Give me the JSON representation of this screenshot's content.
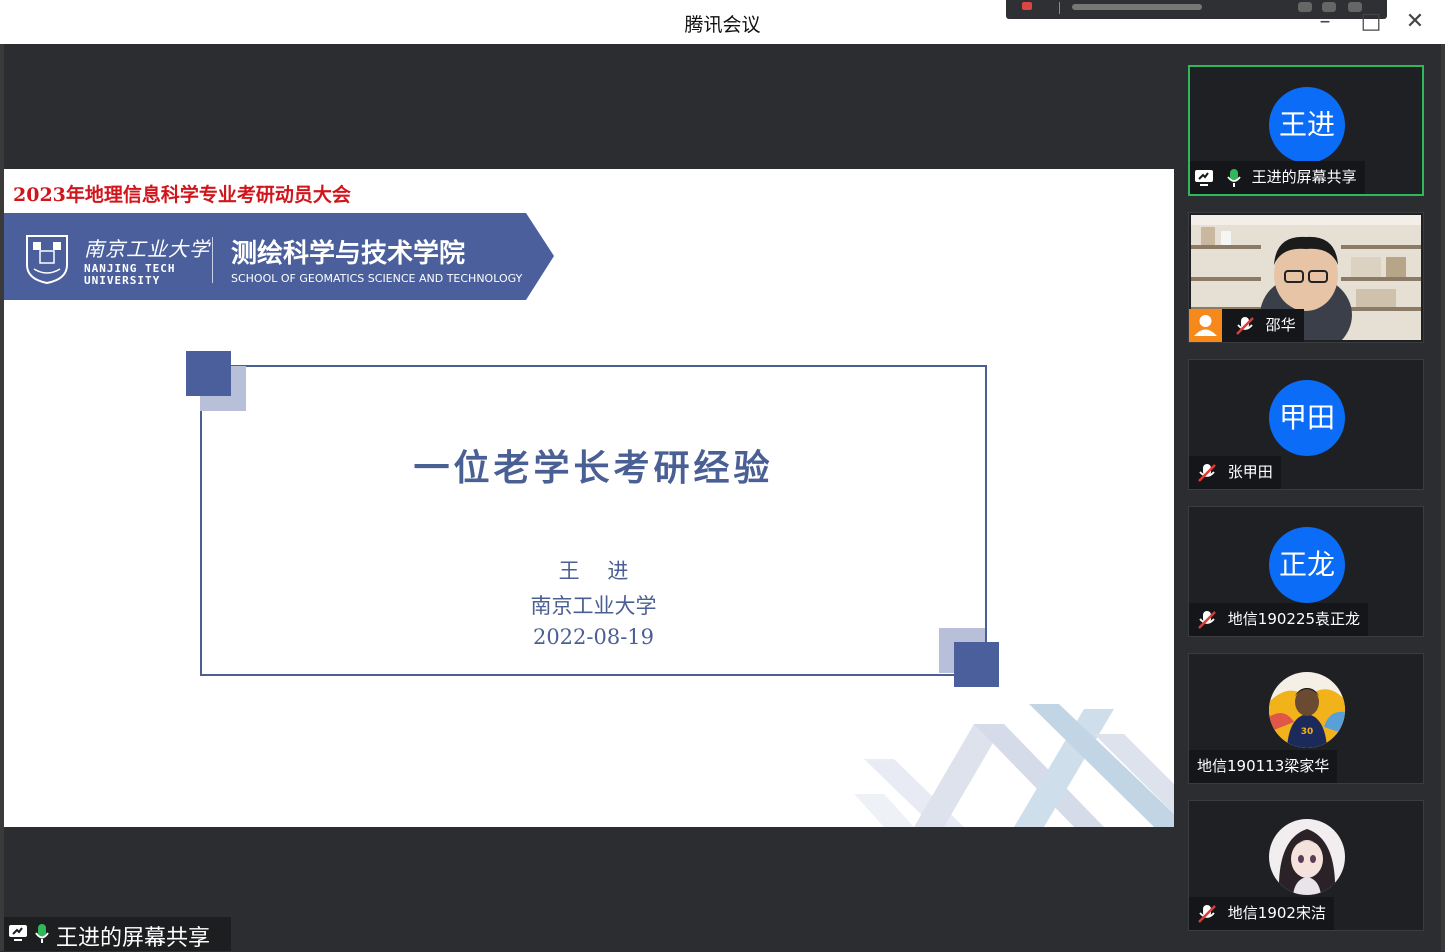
{
  "window": {
    "title": "腾讯会议"
  },
  "slide": {
    "event_title": "2023年地理信息科学专业考研动员大会",
    "university_cn": "南京工业大学",
    "university_en_line1": "NANJING TECH",
    "university_en_line2": "UNIVERSITY",
    "school_cn": "测绘科学与技术学院",
    "school_en": "SCHOOL OF GEOMATICS SCIENCE AND TECHNOLOGY",
    "main_title": "一位老学长考研经验",
    "presenter": "王　 进",
    "institution": "南京工业大学",
    "date": "2022-08-19"
  },
  "share_label": "王进的屏幕共享",
  "participants": [
    {
      "avatar_text": "王进",
      "label": "王进的屏幕共享",
      "mic": "on",
      "sharing": true,
      "active": true
    },
    {
      "avatar_text": "",
      "label": "邵华",
      "mic": "muted",
      "video": true
    },
    {
      "avatar_text": "甲田",
      "label": "张甲田",
      "mic": "muted"
    },
    {
      "avatar_text": "正龙",
      "label": "地信190225袁正龙",
      "mic": "muted"
    },
    {
      "avatar_text": "",
      "label": "地信190113梁家华",
      "mic": "none",
      "avatar_image": "basketball-player"
    },
    {
      "avatar_text": "",
      "label": "地信1902宋洁",
      "mic": "muted",
      "avatar_image": "anime-girl"
    }
  ],
  "colors": {
    "accent_blue": "#0a6cf7",
    "slide_blue": "#4a5f93",
    "event_red": "#d0161c",
    "active_green": "#2fb75a"
  }
}
